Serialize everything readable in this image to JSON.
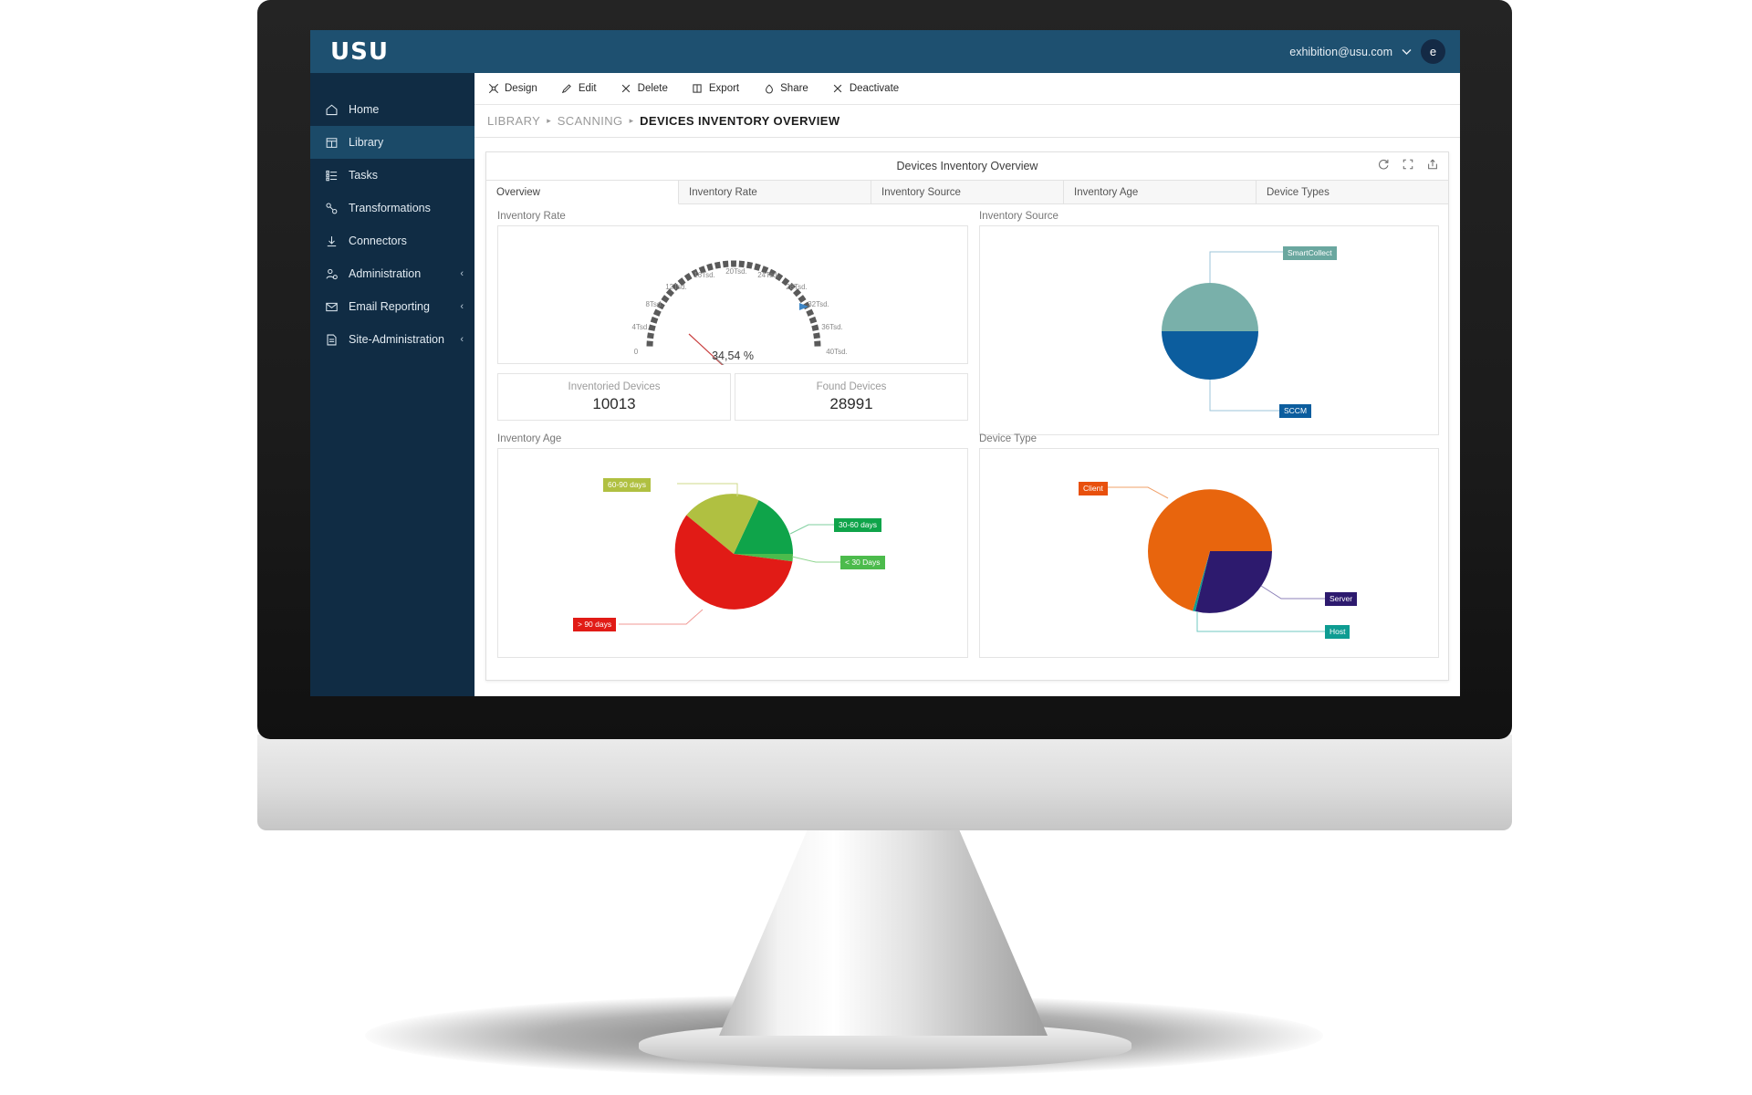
{
  "header": {
    "brand": "USU",
    "user_email": "exhibition@usu.com",
    "avatar_letter": "e",
    "chevron": "⌄"
  },
  "sidebar": {
    "menu_icon": "hamburger-icon",
    "items": [
      {
        "label": "Home",
        "icon": "home-icon",
        "active": false,
        "caret": ""
      },
      {
        "label": "Library",
        "icon": "library-icon",
        "active": true,
        "caret": ""
      },
      {
        "label": "Tasks",
        "icon": "tasks-icon",
        "active": false,
        "caret": ""
      },
      {
        "label": "Transformations",
        "icon": "transformations-icon",
        "active": false,
        "caret": ""
      },
      {
        "label": "Connectors",
        "icon": "connectors-icon",
        "active": false,
        "caret": ""
      },
      {
        "label": "Administration",
        "icon": "administration-icon",
        "active": false,
        "caret": "‹"
      },
      {
        "label": "Email Reporting",
        "icon": "email-reporting-icon",
        "active": false,
        "caret": "‹"
      },
      {
        "label": "Site-Administration",
        "icon": "site-administration-icon",
        "active": false,
        "caret": "‹"
      }
    ]
  },
  "toolbar": {
    "items": [
      {
        "label": "Design",
        "icon": "design-icon"
      },
      {
        "label": "Edit",
        "icon": "pencil-icon"
      },
      {
        "label": "Delete",
        "icon": "close-icon"
      },
      {
        "label": "Export",
        "icon": "export-icon"
      },
      {
        "label": "Share",
        "icon": "share-icon"
      },
      {
        "label": "Deactivate",
        "icon": "close-icon"
      }
    ]
  },
  "breadcrumb": {
    "items": [
      "LIBRARY",
      "SCANNING",
      "DEVICES INVENTORY OVERVIEW"
    ],
    "separator": "▸"
  },
  "panel": {
    "title": "Devices Inventory Overview",
    "actions": [
      {
        "name": "refresh-icon"
      },
      {
        "name": "fullscreen-icon"
      },
      {
        "name": "upload-icon"
      }
    ],
    "tabs": [
      {
        "label": "Overview",
        "active": true
      },
      {
        "label": "Inventory Rate",
        "active": false
      },
      {
        "label": "Inventory Source",
        "active": false
      },
      {
        "label": "Inventory Age",
        "active": false
      },
      {
        "label": "Device Types",
        "active": false
      }
    ]
  },
  "widgets": {
    "inventory_rate_label": "Inventory Rate",
    "inventory_source_label": "Inventory Source",
    "inventory_age_label": "Inventory Age",
    "device_type_label": "Device Type"
  },
  "kpis": [
    {
      "label": "Inventoried Devices",
      "value": "10013"
    },
    {
      "label": "Found Devices",
      "value": "28991"
    }
  ],
  "chart_data": [
    {
      "type": "gauge",
      "title": "Inventory Rate",
      "value_label": "34,54 %",
      "value": 34.54,
      "needle_value": 10013,
      "min": 0,
      "max": 40000,
      "tick_labels": [
        "0",
        "4Tsd.",
        "8Tsd.",
        "12Tsd.",
        "16Tsd.",
        "20Tsd.",
        "24Tsd.",
        "28Tsd.",
        "32Tsd.",
        "36Tsd.",
        "40Tsd."
      ],
      "tick_values": [
        0,
        4000,
        8000,
        12000,
        16000,
        20000,
        24000,
        28000,
        32000,
        36000,
        40000
      ],
      "target_marker_value": 28991,
      "arc_color": "#5a5a5a",
      "needle_color": "#c94040"
    },
    {
      "type": "pie",
      "title": "Inventory Source",
      "categories": [
        "SmartCollect",
        "SCCM"
      ],
      "values": [
        50,
        50
      ],
      "colors": [
        "#79b0aa",
        "#0c5d9e"
      ],
      "legend": "callout-labels"
    },
    {
      "type": "pie",
      "title": "Inventory Age",
      "categories": [
        "> 90 days",
        "60-90 days",
        "30-60 days",
        "< 30 Days"
      ],
      "values": [
        65,
        13,
        20,
        2
      ],
      "colors": [
        "#e11b16",
        "#b0c041",
        "#0fa44a",
        "#4cbb4c"
      ],
      "legend": "callout-labels"
    },
    {
      "type": "pie",
      "title": "Device Type",
      "categories": [
        "Client",
        "Server",
        "Host"
      ],
      "values": [
        78,
        21,
        1
      ],
      "colors": [
        "#e8650d",
        "#2d1a6e",
        "#0e9c92"
      ],
      "legend": "callout-labels"
    }
  ]
}
